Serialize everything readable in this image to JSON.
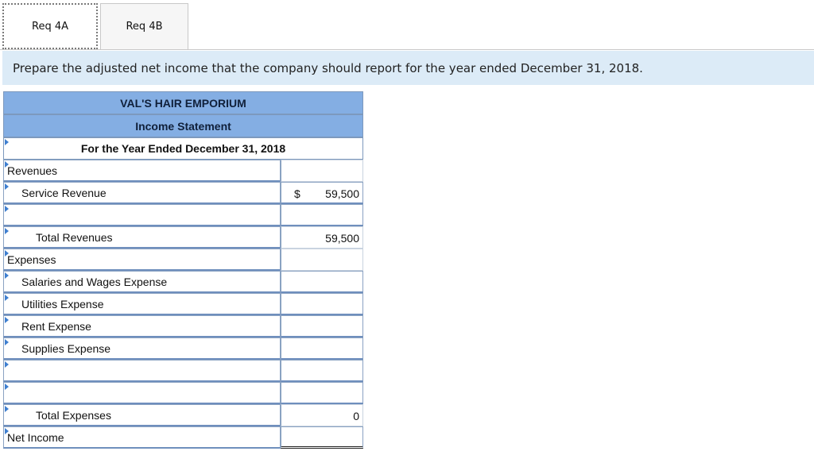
{
  "tabs": [
    {
      "label": "Req 4A",
      "active": true
    },
    {
      "label": "Req 4B",
      "active": false
    }
  ],
  "instruction": "Prepare the adjusted net income that the company should report for the year ended December 31, 2018.",
  "statement": {
    "company": "VAL'S HAIR EMPORIUM",
    "title": "Income Statement",
    "period": "For the Year Ended December 31, 2018",
    "revenues_header": "Revenues",
    "service_revenue": {
      "label": "Service Revenue",
      "currency": "$",
      "value": "59,500"
    },
    "revenue_blank_row": {
      "label": "",
      "value": ""
    },
    "total_revenues": {
      "label": "Total Revenues",
      "value": "59,500"
    },
    "expenses_header": "Expenses",
    "expenses": [
      {
        "label": "Salaries and Wages Expense",
        "value": ""
      },
      {
        "label": "Utilities Expense",
        "value": ""
      },
      {
        "label": "Rent Expense",
        "value": ""
      },
      {
        "label": "Supplies Expense",
        "value": ""
      },
      {
        "label": "",
        "value": ""
      },
      {
        "label": "",
        "value": ""
      }
    ],
    "total_expenses": {
      "label": "Total Expenses",
      "value": "0"
    },
    "net_income": {
      "label": "Net Income",
      "value": ""
    }
  },
  "colors": {
    "header_fill": "#84aee3",
    "instruction_fill": "#dcebf7",
    "cell_border": "#6f8fbd",
    "input_marker": "#3f7fd0"
  }
}
